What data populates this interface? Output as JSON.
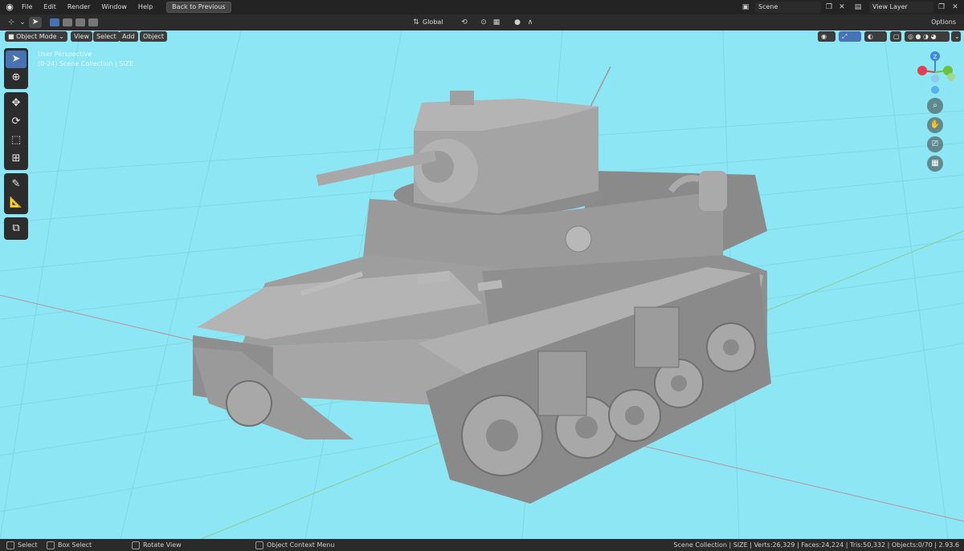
{
  "menu": {
    "items": [
      "File",
      "Edit",
      "Render",
      "Window",
      "Help"
    ],
    "back_button": "Back to Previous"
  },
  "scene": {
    "name": "Scene"
  },
  "view_layer": {
    "name": "View Layer"
  },
  "header": {
    "transform_orientation": "Global",
    "options": "Options"
  },
  "viewport_header": {
    "mode": "Object Mode",
    "view": "View",
    "select": "Select",
    "add": "Add",
    "object": "Object"
  },
  "viewport_info": {
    "line1": "User Perspective",
    "line2": "(0-24) Scene Collection | SIZE"
  },
  "gizmo": {
    "z_label": "Z",
    "x_color": "#e04050",
    "y_color": "#6ac33a",
    "z_color": "#3a8ae0"
  },
  "status": {
    "select": "Select",
    "box_select": "Box Select",
    "rotate_view": "Rotate View",
    "context_menu": "Object Context Menu",
    "stats": "Scene Collection | SIZE | Verts:26,329 | Faces:24,224 | Tris:50,332 | Objects:0/70 | 2.93.6"
  },
  "colors": {
    "viewport_bg": "#8ce6f3",
    "active_tool": "#4772b3"
  }
}
